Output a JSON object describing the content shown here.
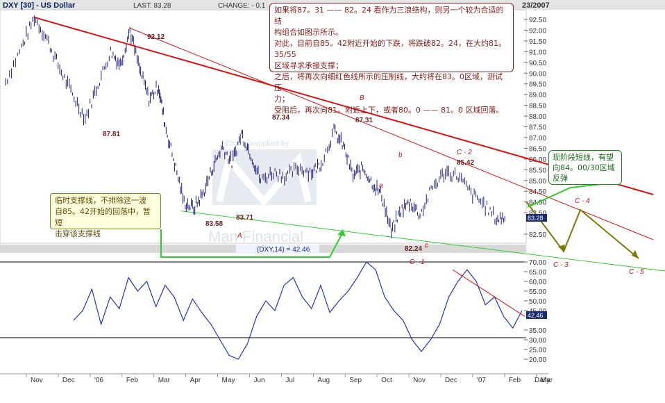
{
  "header": {
    "symbol": "DXY [30] - US Dollar",
    "last_label": "LAST: 83.28",
    "change_label": "CHANGE:  - 0.1",
    "date_fragment": "23/2007"
  },
  "price_axis": {
    "ticks": [
      "92.50",
      "92.00",
      "91.50",
      "91.00",
      "90.50",
      "90.00",
      "89.50",
      "89.00",
      "88.50",
      "88.00",
      "87.50",
      "87.00",
      "86.50",
      "86.00",
      "85.50",
      "85.00",
      "84.50",
      "84.00",
      "83.50",
      "83.28",
      "82.50"
    ],
    "last_tag": "83.28"
  },
  "indicator_axis": {
    "ticks": [
      "70.00",
      "65.00",
      "60.00",
      "55.00",
      "50.00",
      "45.00",
      "42.46",
      "35.00",
      "30.00",
      "25.00",
      "20.00"
    ],
    "last_tag": "42.46"
  },
  "time_axis": {
    "labels": [
      "Nov",
      "Dec",
      "'06",
      "Feb",
      "Mar",
      "Apr",
      "May",
      "Jun",
      "Jul",
      "Aug",
      "Sep",
      "Oct",
      "Nov",
      "Dec",
      "'07",
      "Feb",
      "Mar",
      "Daily"
    ]
  },
  "indicator_label": "(DXY,14) = 42.46",
  "watermark": {
    "top": "Charts supplied by:",
    "bottom": "Man Financial"
  },
  "price_labels": {
    "p9212": "92.12",
    "p8781": "87.81",
    "p8734": "87.34",
    "p8731": "87.31",
    "p8542": "85.42",
    "p8358": "83.58",
    "p8371": "83.71",
    "p8224": "82.24"
  },
  "wave_labels": {
    "A": "A",
    "B": "B",
    "a": "a",
    "b": "b",
    "c": "c",
    "C1": "C - 1",
    "C2": "C - 2",
    "C3": "C - 3",
    "C4": "C - 4",
    "C5": "C - 5"
  },
  "callouts": {
    "top": [
      "如果将87。31 —— 82。24 看作为三浪结构，则另一个较为合适的结",
      "构组合如图示所示。",
      "对此，目前自85。42附近开始的下跌，将跌破82。24，在大约81。35/55",
      "区域寻求承接支撑；",
      "之后，将再次向细红色线所示的压制线，大约将在83。0区域，测试压",
      "力；",
      "受阻后，再次向81。附近上下，或者80。0 —— 81。0 区域回落。"
    ],
    "left": [
      "临时支撑线，不排除这一波",
      "自85。42开始的回落中，暂短",
      "击穿该支撑线"
    ],
    "right": [
      "现阶段短线，有望",
      "向84。00/30区域",
      "反弹"
    ]
  },
  "chart_data": {
    "type": "line",
    "title": "DXY [30] - US Dollar",
    "subtitle": "Daily",
    "xlabel": "",
    "ylabel": "",
    "ylim": [
      82.0,
      92.8
    ],
    "x": [
      "Nov",
      "Dec",
      "'06",
      "Feb",
      "Mar",
      "Apr",
      "May",
      "Jun",
      "Jul",
      "Aug",
      "Sep",
      "Oct",
      "Nov",
      "Dec",
      "'07",
      "Feb",
      "Mar"
    ],
    "price_points": [
      [
        0.0,
        89.6
      ],
      [
        0.5,
        91.2
      ],
      [
        0.9,
        92.6
      ],
      [
        1.3,
        91.6
      ],
      [
        1.7,
        90.2
      ],
      [
        2.1,
        89.0
      ],
      [
        2.5,
        87.9
      ],
      [
        2.9,
        89.5
      ],
      [
        3.3,
        91.0
      ],
      [
        3.6,
        90.4
      ],
      [
        3.9,
        92.0
      ],
      [
        4.2,
        90.2
      ],
      [
        4.5,
        88.8
      ],
      [
        4.8,
        89.4
      ],
      [
        5.0,
        87.6
      ],
      [
        5.3,
        85.8
      ],
      [
        5.6,
        84.0
      ],
      [
        5.9,
        83.7
      ],
      [
        6.2,
        84.4
      ],
      [
        6.5,
        85.6
      ],
      [
        6.8,
        86.6
      ],
      [
        7.1,
        85.8
      ],
      [
        7.4,
        87.2
      ],
      [
        7.7,
        86.2
      ],
      [
        8.0,
        85.0
      ],
      [
        8.4,
        85.4
      ],
      [
        8.8,
        85.2
      ],
      [
        9.2,
        85.6
      ],
      [
        9.6,
        85.4
      ],
      [
        9.9,
        85.8
      ],
      [
        10.3,
        87.3
      ],
      [
        10.6,
        86.6
      ],
      [
        10.9,
        85.2
      ],
      [
        11.2,
        85.6
      ],
      [
        11.5,
        84.9
      ],
      [
        11.8,
        84.3
      ],
      [
        12.1,
        82.6
      ],
      [
        12.4,
        83.6
      ],
      [
        12.7,
        84.0
      ],
      [
        13.0,
        83.4
      ],
      [
        13.4,
        84.7
      ],
      [
        13.8,
        85.4
      ],
      [
        14.2,
        85.2
      ],
      [
        14.6,
        84.4
      ],
      [
        15.0,
        83.9
      ],
      [
        15.4,
        83.2
      ],
      [
        15.7,
        83.3
      ]
    ],
    "indicator": {
      "name": "(DXY,14)",
      "ylim": [
        18,
        72
      ],
      "last": 42.46,
      "values": [
        40,
        45,
        56,
        38,
        52,
        46,
        62,
        55,
        60,
        47,
        58,
        52,
        40,
        51,
        44,
        38,
        30,
        22,
        20,
        28,
        42,
        50,
        45,
        58,
        62,
        52,
        46,
        58,
        44,
        50,
        55,
        62,
        70,
        66,
        52,
        45,
        40,
        30,
        24,
        30,
        38,
        52,
        60,
        66,
        60,
        48,
        52,
        42,
        36,
        45
      ]
    },
    "trendlines": [
      {
        "label": "B",
        "color": "#dd1111",
        "from": [
          0.9,
          92.6
        ],
        "to": [
          16.4,
          86.1
        ]
      },
      {
        "label": "",
        "color": "#dd1111",
        "from": [
          3.9,
          92.1
        ],
        "to": [
          16.4,
          84.4
        ]
      },
      {
        "label": "",
        "color": "#33cc33",
        "from": [
          5.5,
          83.58
        ],
        "to": [
          16.4,
          81.9
        ]
      }
    ],
    "projection": {
      "color": "#7a7a00",
      "path": [
        "C - 3",
        "C - 4",
        "C - 5"
      ]
    },
    "legend": "none",
    "grid": false
  }
}
